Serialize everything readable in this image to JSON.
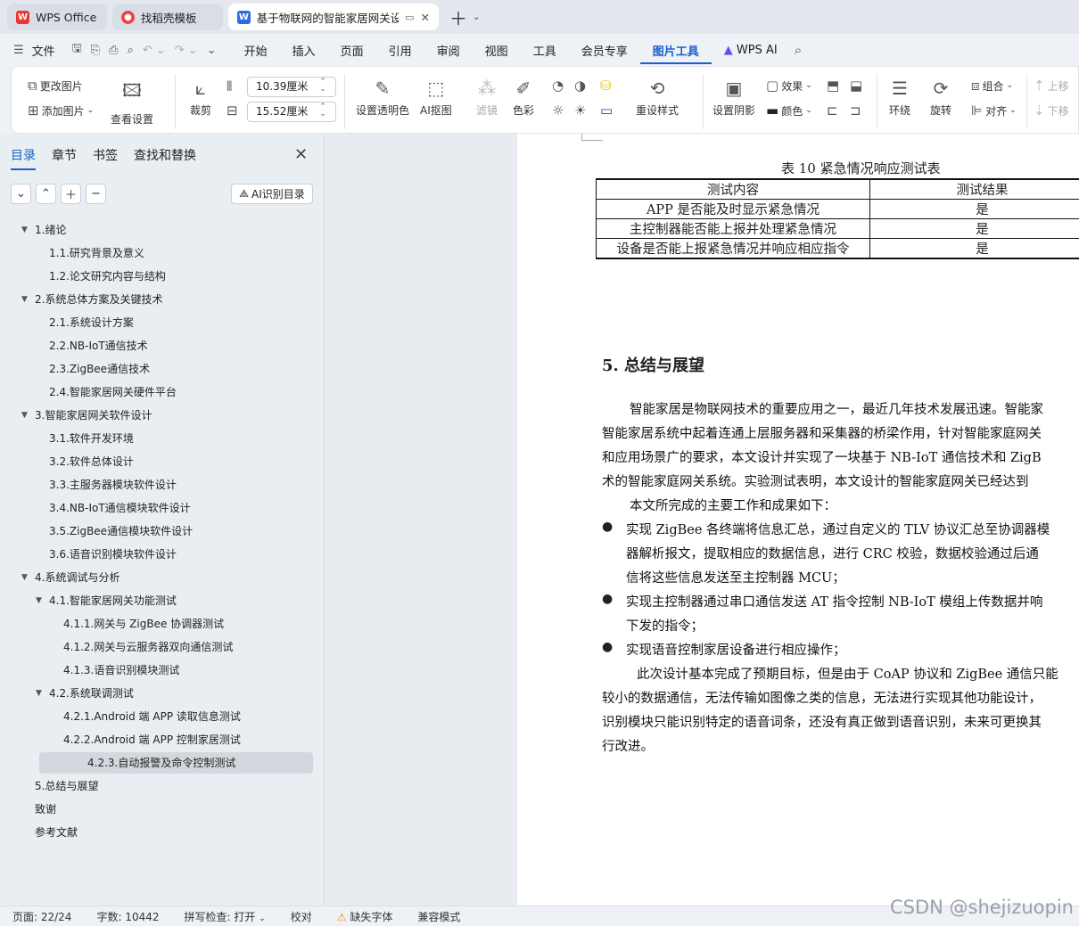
{
  "tabs": [
    {
      "label": "WPS Office",
      "icon": "wps-icon"
    },
    {
      "label": "找稻壳模板",
      "icon": "docer-icon"
    },
    {
      "label": "基于物联网的智能家居网关设",
      "icon": "word-doc-icon"
    }
  ],
  "menu": {
    "file": "文件",
    "items": [
      "开始",
      "插入",
      "页面",
      "引用",
      "审阅",
      "视图",
      "工具",
      "会员专享",
      "图片工具",
      "WPS AI"
    ],
    "selected": "图片工具"
  },
  "ribbon": {
    "change_image": "更改图片",
    "add_image": "添加图片",
    "view_settings": "查看设置",
    "crop": "裁剪",
    "width": "10.39厘米",
    "height": "15.52厘米",
    "set_transparent": "设置透明色",
    "ai_cutout": "AI抠图",
    "filter": "滤镜",
    "color": "色彩",
    "reset_style": "重设样式",
    "set_shadow": "设置阴影",
    "effect": "效果",
    "border_color": "颜色",
    "wrap": "环绕",
    "rotate": "旋转",
    "group": "组合",
    "align": "对齐",
    "move_up": "上移",
    "move_down": "下移"
  },
  "sidebar": {
    "tabs": [
      "目录",
      "章节",
      "书签",
      "查找和替换"
    ],
    "ai_toc": "AI识别目录",
    "toc": [
      {
        "label": "1.绪论",
        "level": 1,
        "expanded": true
      },
      {
        "label": "1.1.研究背景及意义",
        "level": 2
      },
      {
        "label": "1.2.论文研究内容与结构",
        "level": 2
      },
      {
        "label": "2.系统总体方案及关键技术",
        "level": 1,
        "expanded": true
      },
      {
        "label": "2.1.系统设计方案",
        "level": 2
      },
      {
        "label": "2.2.NB-IoT通信技术",
        "level": 2
      },
      {
        "label": "2.3.ZigBee通信技术",
        "level": 2
      },
      {
        "label": "2.4.智能家居网关硬件平台",
        "level": 2
      },
      {
        "label": "3.智能家居网关软件设计",
        "level": 1,
        "expanded": true
      },
      {
        "label": "3.1.软件开发环境",
        "level": 2
      },
      {
        "label": "3.2.软件总体设计",
        "level": 2
      },
      {
        "label": "3.3.主服务器模块软件设计",
        "level": 2
      },
      {
        "label": "3.4.NB-IoT通信模块软件设计",
        "level": 2
      },
      {
        "label": "3.5.ZigBee通信模块软件设计",
        "level": 2
      },
      {
        "label": "3.6.语音识别模块软件设计",
        "level": 2
      },
      {
        "label": "4.系统调试与分析",
        "level": 1,
        "expanded": true
      },
      {
        "label": "4.1.智能家居网关功能测试",
        "level": 2,
        "expanded": true
      },
      {
        "label": "4.1.1.网关与 ZigBee 协调器测试",
        "level": 3
      },
      {
        "label": "4.1.2.网关与云服务器双向通信测试",
        "level": 3
      },
      {
        "label": "4.1.3.语音识别模块测试",
        "level": 3
      },
      {
        "label": "4.2.系统联调测试",
        "level": 2,
        "expanded": true
      },
      {
        "label": "4.2.1.Android 端 APP 读取信息测试",
        "level": 3
      },
      {
        "label": "4.2.2.Android 端 APP 控制家居测试",
        "level": 3
      },
      {
        "label": "4.2.3.自动报警及命令控制测试",
        "level": 3,
        "selected": true
      },
      {
        "label": "5.总结与展望",
        "level": 1
      },
      {
        "label": "致谢",
        "level": 1
      },
      {
        "label": "参考文献",
        "level": 1
      }
    ]
  },
  "document": {
    "table_caption": "表  10  紧急情况响应测试表",
    "table": {
      "headers": [
        "测试内容",
        "测试结果"
      ],
      "rows": [
        [
          "APP 是否能及时显示紧急情况",
          "是"
        ],
        [
          "主控制器能否能上报并处理紧急情况",
          "是"
        ],
        [
          "设备是否能上报紧急情况并响应相应指令",
          "是"
        ]
      ]
    },
    "heading": "5.  总结与展望",
    "lines": [
      "智能家居是物联网技术的重要应用之一，最近几年技术发展迅速。智能家",
      "智能家居系统中起着连通上层服务器和采集器的桥梁作用，针对智能家庭网关",
      "和应用场景广的要求，本文设计并实现了一块基于 NB-IoT 通信技术和 ZigB",
      "术的智能家庭网关系统。实验测试表明，本文设计的智能家庭网关已经达到",
      "本文所完成的主要工作和成果如下："
    ],
    "bullets": [
      [
        "实现 ZigBee 各终端将信息汇总，通过自定义的 TLV 协议汇总至协调器模",
        "器解析报文，提取相应的数据信息，进行 CRC 校验，数据校验通过后通",
        "信将这些信息发送至主控制器 MCU；"
      ],
      [
        "实现主控制器通过串口通信发送 AT 指令控制 NB-IoT 模组上传数据并响",
        "下发的指令；"
      ],
      [
        "实现语音控制家居设备进行相应操作；"
      ]
    ],
    "closing": [
      "此次设计基本完成了预期目标，但是由于 CoAP 协议和 ZigBee 通信只能",
      "较小的数据通信，无法传输如图像之类的信息，无法进行实现其他功能设计，",
      "识别模块只能识别特定的语音词条，还没有真正做到语音识别，未来可更换其",
      "行改进。"
    ]
  },
  "status": {
    "page": "页面: 22/24",
    "words": "字数: 10442",
    "spell": "拼写检查: 打开",
    "proof": "校对",
    "missing_font": "缺失字体",
    "compat": "兼容模式"
  },
  "watermark": "CSDN @shejizuopin"
}
